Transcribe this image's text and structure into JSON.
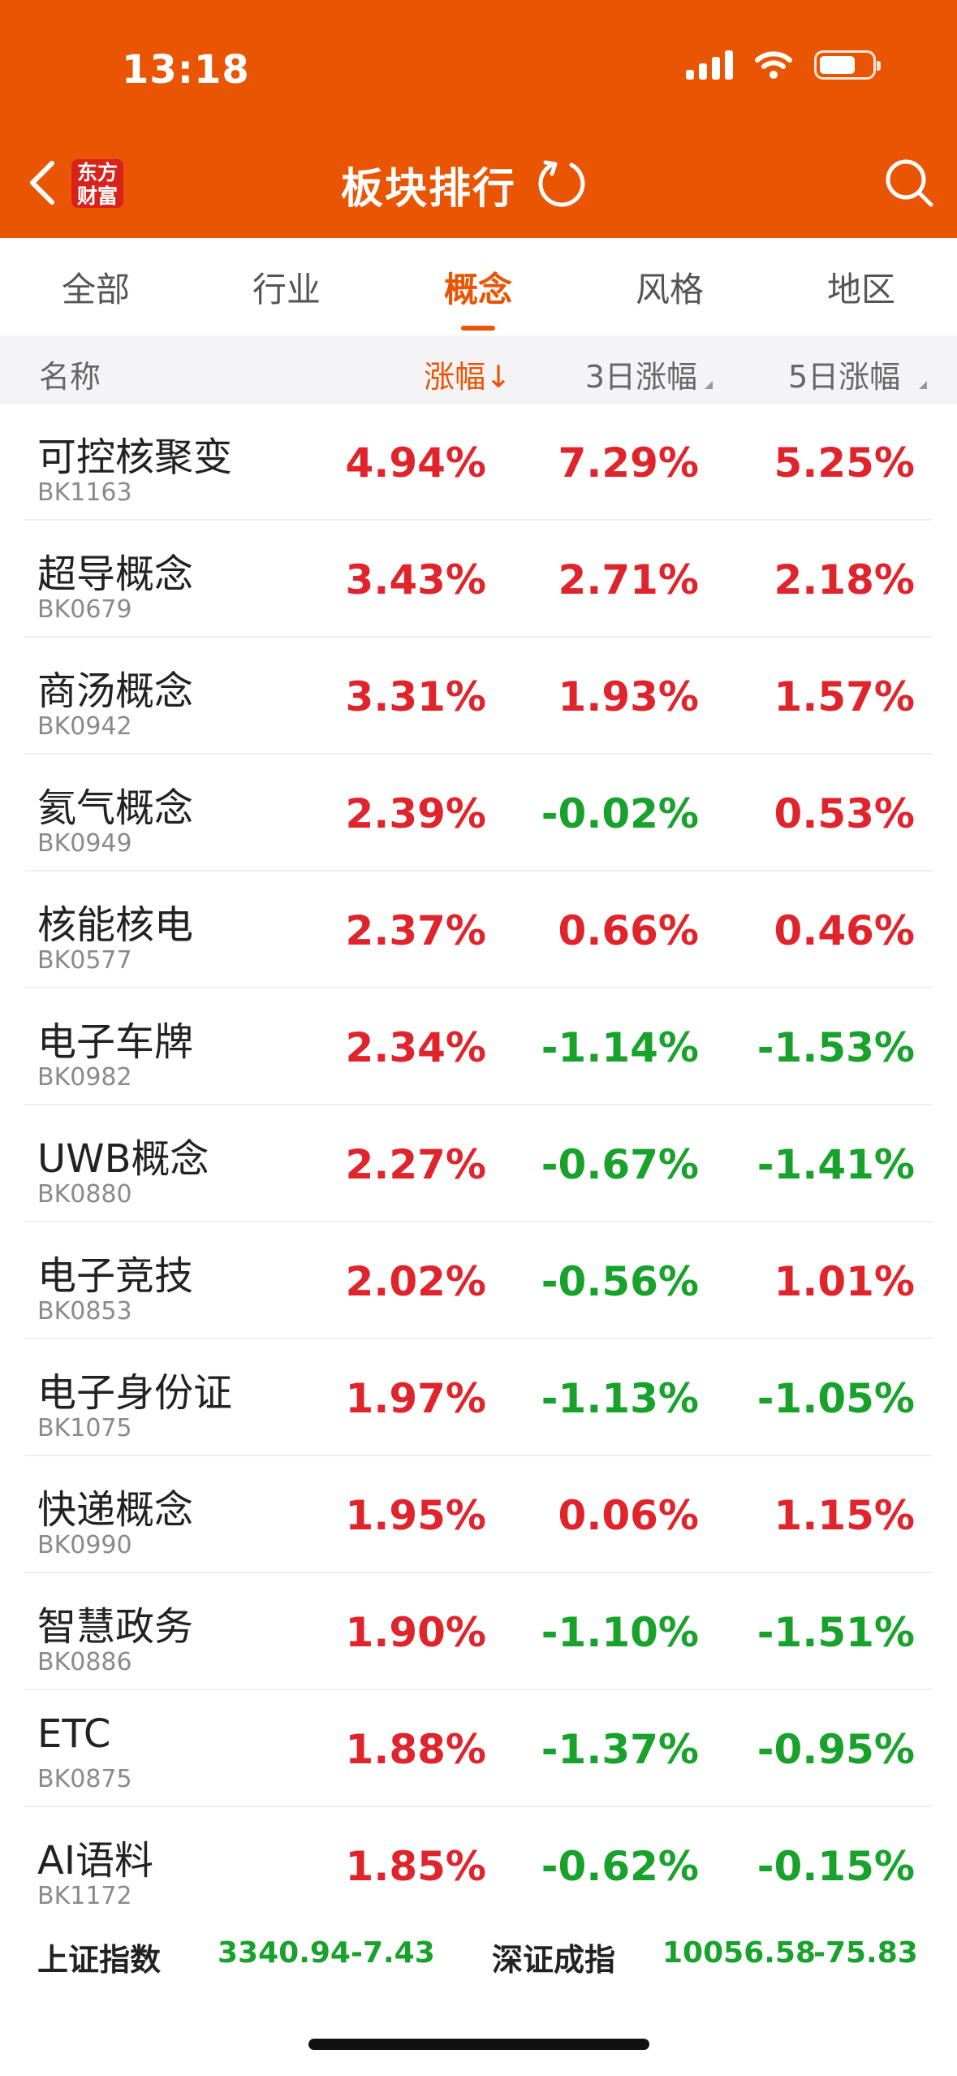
{
  "status_bar": {
    "time": "13:18"
  },
  "header": {
    "logo_line1": "东方",
    "logo_line2": "财富",
    "title": "板块排行"
  },
  "tabs": [
    {
      "label": "全部",
      "active": false
    },
    {
      "label": "行业",
      "active": false
    },
    {
      "label": "概念",
      "active": true
    },
    {
      "label": "风格",
      "active": false
    },
    {
      "label": "地区",
      "active": false
    }
  ],
  "columns": {
    "name": "名称",
    "change": "涨幅",
    "change_sort_arrow": "↓",
    "change_3d": "3日涨幅",
    "change_5d": "5日涨幅"
  },
  "rows": [
    {
      "name": "可控核聚变",
      "code": "BK1163",
      "chg": "4.94%",
      "chg_dir": "up",
      "chg3": "7.29%",
      "chg3_dir": "up",
      "chg5": "5.25%",
      "chg5_dir": "up"
    },
    {
      "name": "超导概念",
      "code": "BK0679",
      "chg": "3.43%",
      "chg_dir": "up",
      "chg3": "2.71%",
      "chg3_dir": "up",
      "chg5": "2.18%",
      "chg5_dir": "up"
    },
    {
      "name": "商汤概念",
      "code": "BK0942",
      "chg": "3.31%",
      "chg_dir": "up",
      "chg3": "1.93%",
      "chg3_dir": "up",
      "chg5": "1.57%",
      "chg5_dir": "up"
    },
    {
      "name": "氦气概念",
      "code": "BK0949",
      "chg": "2.39%",
      "chg_dir": "up",
      "chg3": "-0.02%",
      "chg3_dir": "down",
      "chg5": "0.53%",
      "chg5_dir": "up"
    },
    {
      "name": "核能核电",
      "code": "BK0577",
      "chg": "2.37%",
      "chg_dir": "up",
      "chg3": "0.66%",
      "chg3_dir": "up",
      "chg5": "0.46%",
      "chg5_dir": "up"
    },
    {
      "name": "电子车牌",
      "code": "BK0982",
      "chg": "2.34%",
      "chg_dir": "up",
      "chg3": "-1.14%",
      "chg3_dir": "down",
      "chg5": "-1.53%",
      "chg5_dir": "down"
    },
    {
      "name": "UWB概念",
      "code": "BK0880",
      "chg": "2.27%",
      "chg_dir": "up",
      "chg3": "-0.67%",
      "chg3_dir": "down",
      "chg5": "-1.41%",
      "chg5_dir": "down"
    },
    {
      "name": "电子竞技",
      "code": "BK0853",
      "chg": "2.02%",
      "chg_dir": "up",
      "chg3": "-0.56%",
      "chg3_dir": "down",
      "chg5": "1.01%",
      "chg5_dir": "up"
    },
    {
      "name": "电子身份证",
      "code": "BK1075",
      "chg": "1.97%",
      "chg_dir": "up",
      "chg3": "-1.13%",
      "chg3_dir": "down",
      "chg5": "-1.05%",
      "chg5_dir": "down"
    },
    {
      "name": "快递概念",
      "code": "BK0990",
      "chg": "1.95%",
      "chg_dir": "up",
      "chg3": "0.06%",
      "chg3_dir": "up",
      "chg5": "1.15%",
      "chg5_dir": "up"
    },
    {
      "name": "智慧政务",
      "code": "BK0886",
      "chg": "1.90%",
      "chg_dir": "up",
      "chg3": "-1.10%",
      "chg3_dir": "down",
      "chg5": "-1.51%",
      "chg5_dir": "down"
    },
    {
      "name": "ETC",
      "code": "BK0875",
      "chg": "1.88%",
      "chg_dir": "up",
      "chg3": "-1.37%",
      "chg3_dir": "down",
      "chg5": "-0.95%",
      "chg5_dir": "down"
    },
    {
      "name": "AI语料",
      "code": "BK1172",
      "chg": "1.85%",
      "chg_dir": "up",
      "chg3": "-0.62%",
      "chg3_dir": "down",
      "chg5": "-0.15%",
      "chg5_dir": "down"
    }
  ],
  "index_bar": {
    "sh_label": "上证指数",
    "sh_value": "3340.94",
    "sh_change": "-7.43",
    "sz_label": "深证成指",
    "sz_value": "10056.58",
    "sz_change": "-75.83"
  },
  "colors": {
    "brand_orange": "#EA5504",
    "up_red": "#E0242C",
    "down_green": "#18A22C"
  },
  "icons": [
    "back-chevron-icon",
    "refresh-icon",
    "search-icon",
    "signal-icon",
    "wifi-icon",
    "battery-icon",
    "sort-desc-icon"
  ]
}
